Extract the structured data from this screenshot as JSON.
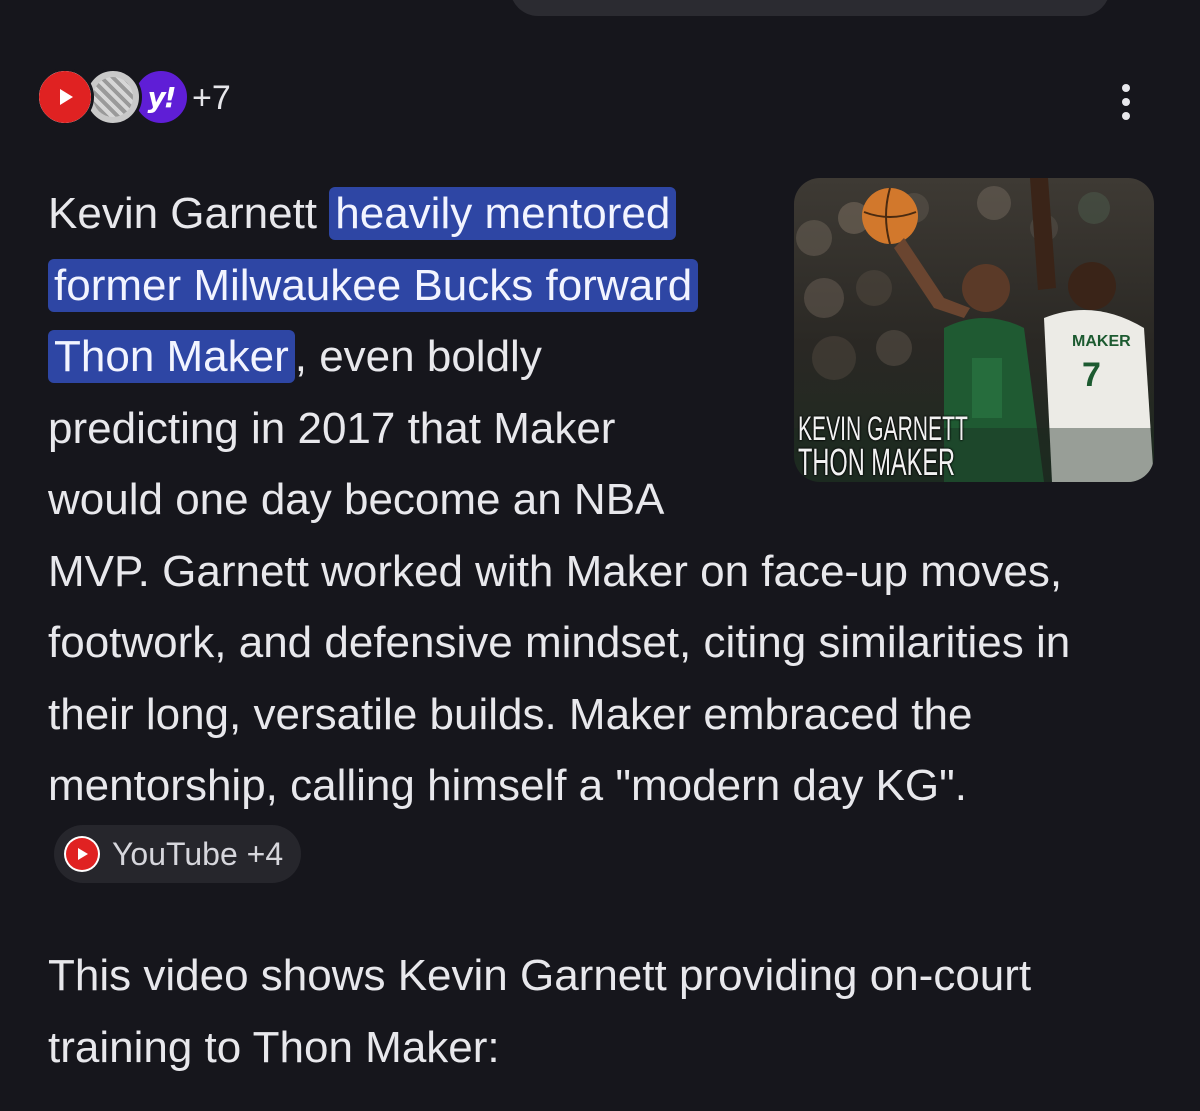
{
  "sources": {
    "icons": [
      "youtube-icon",
      "generic-site-icon",
      "yahoo-icon"
    ],
    "more_count": "+7"
  },
  "thumbnail": {
    "caption_line1": "KEVIN GARNETT",
    "caption_line2": "THON MAKER",
    "jersey_name": "MAKER",
    "jersey_number": "7"
  },
  "answer": {
    "lead": "Kevin Garnett ",
    "highlight": "heavily mentored former Milwaukee Bucks forward Thon Maker",
    "after_highlight": ", even boldly predicting in 2017 that Maker would one day become an NBA MVP. Garnett worked with Maker on face-up moves, footwork, and defensive mindset, citing similarities in their long, versatile builds. Maker embraced the mentorship, calling himself a \"modern day KG\".",
    "source_chip": "YouTube +4",
    "video_intro": "This video shows Kevin Garnett providing on-court training to Thon Maker:"
  },
  "colors": {
    "background": "#16161c",
    "highlight": "#2e46a4",
    "chip_background": "#26262c",
    "youtube_red": "#e02222",
    "yahoo_purple": "#5f1ed6"
  }
}
